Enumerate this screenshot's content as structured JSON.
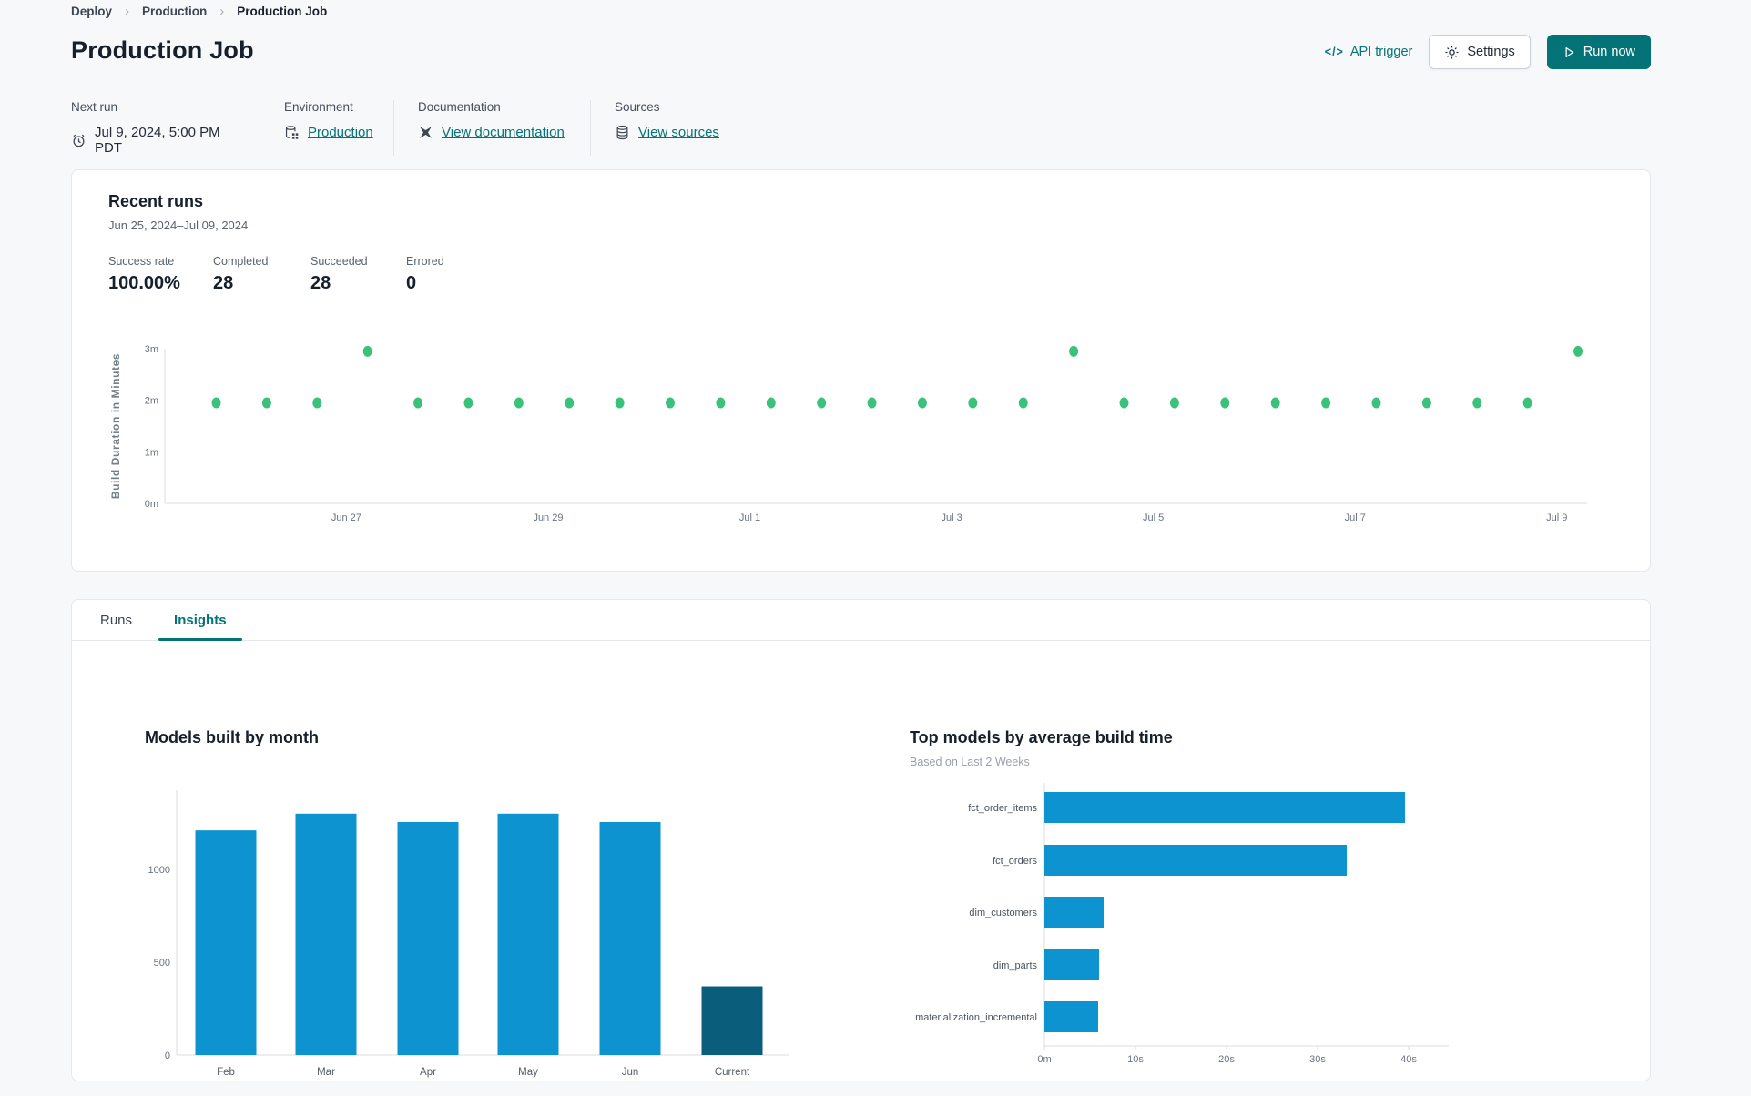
{
  "breadcrumb": {
    "separator": "›",
    "items": [
      "Deploy",
      "Production",
      "Production Job"
    ]
  },
  "header": {
    "title": "Production Job",
    "api_trigger": "API trigger",
    "settings": "Settings",
    "run_now": "Run now"
  },
  "icons": {
    "api_trigger_glyph": "</>",
    "clock": "alarm-clock",
    "environment": "database-grid",
    "documentation": "dbt-docs",
    "sources": "database-stack"
  },
  "meta": {
    "next_run": {
      "label": "Next run",
      "value": "Jul 9, 2024, 5:00 PM PDT"
    },
    "environment": {
      "label": "Environment",
      "value": "Production"
    },
    "documentation": {
      "label": "Documentation",
      "value": "View documentation"
    },
    "sources": {
      "label": "Sources",
      "value": "View sources"
    }
  },
  "recent_runs": {
    "title": "Recent runs",
    "date_range": "Jun 25, 2024–Jul 09, 2024",
    "stats": [
      {
        "label": "Success rate",
        "value": "100.00%"
      },
      {
        "label": "Completed",
        "value": "28"
      },
      {
        "label": "Succeeded",
        "value": "28"
      },
      {
        "label": "Errored",
        "value": "0"
      }
    ]
  },
  "tabs": {
    "runs": "Runs",
    "insights": "Insights"
  },
  "colors": {
    "accent_teal": "#047377",
    "success_green": "#3bc27a",
    "bar_blue": "#0d93cf",
    "bar_current": "#0b5d7c",
    "axis_line": "#d8dcdf"
  },
  "chart_data": [
    {
      "id": "build_duration",
      "type": "scatter",
      "title": "",
      "ylabel": "Build Duration in Minutes",
      "xlabel": "",
      "point_color": "#3bc27a",
      "xlim_days": [
        0.2,
        14.3
      ],
      "ylim_minutes": [
        0,
        3.2
      ],
      "x_ticks": [
        {
          "label": "Jun 27",
          "d": 2
        },
        {
          "label": "Jun 29",
          "d": 4
        },
        {
          "label": "Jul 1",
          "d": 6
        },
        {
          "label": "Jul 3",
          "d": 8
        },
        {
          "label": "Jul 5",
          "d": 10
        },
        {
          "label": "Jul 7",
          "d": 12
        },
        {
          "label": "Jul 9",
          "d": 14
        }
      ],
      "y_ticks": [
        {
          "label": "0m",
          "m": 0
        },
        {
          "label": "1m",
          "m": 1
        },
        {
          "label": "2m",
          "m": 2
        },
        {
          "label": "3m",
          "m": 3
        }
      ],
      "points": [
        {
          "d": 0.71,
          "m": 1.95
        },
        {
          "d": 1.21,
          "m": 1.95
        },
        {
          "d": 1.71,
          "m": 1.95
        },
        {
          "d": 2.21,
          "m": 2.95
        },
        {
          "d": 2.71,
          "m": 1.95
        },
        {
          "d": 3.21,
          "m": 1.95
        },
        {
          "d": 3.71,
          "m": 1.95
        },
        {
          "d": 4.21,
          "m": 1.95
        },
        {
          "d": 4.71,
          "m": 1.95
        },
        {
          "d": 5.21,
          "m": 1.95
        },
        {
          "d": 5.71,
          "m": 1.95
        },
        {
          "d": 6.21,
          "m": 1.95
        },
        {
          "d": 6.71,
          "m": 1.95
        },
        {
          "d": 7.21,
          "m": 1.95
        },
        {
          "d": 7.71,
          "m": 1.95
        },
        {
          "d": 8.21,
          "m": 1.95
        },
        {
          "d": 8.71,
          "m": 1.95
        },
        {
          "d": 9.21,
          "m": 2.95
        },
        {
          "d": 9.71,
          "m": 1.95
        },
        {
          "d": 10.21,
          "m": 1.95
        },
        {
          "d": 10.71,
          "m": 1.95
        },
        {
          "d": 11.21,
          "m": 1.95
        },
        {
          "d": 11.71,
          "m": 1.95
        },
        {
          "d": 12.21,
          "m": 1.95
        },
        {
          "d": 12.71,
          "m": 1.95
        },
        {
          "d": 13.21,
          "m": 1.95
        },
        {
          "d": 13.71,
          "m": 1.95
        },
        {
          "d": 14.21,
          "m": 2.95
        }
      ]
    },
    {
      "id": "models_by_month",
      "type": "bar",
      "title": "Models built by month",
      "xlabel": "",
      "ylabel": "",
      "categories": [
        "Feb",
        "Mar",
        "Apr",
        "May",
        "Jun",
        "Current"
      ],
      "values": [
        1210,
        1300,
        1255,
        1300,
        1255,
        370
      ],
      "bar_colors": [
        "#0d93cf",
        "#0d93cf",
        "#0d93cf",
        "#0d93cf",
        "#0d93cf",
        "#0b5d7c"
      ],
      "y_ticks": [
        0,
        500,
        1000
      ],
      "ylim": [
        0,
        1400
      ]
    },
    {
      "id": "top_models",
      "type": "horizontal_bar",
      "title": "Top models by average build time",
      "subtitle": "Based on Last 2 Weeks",
      "categories": [
        "fct_order_items",
        "fct_orders",
        "dim_customers",
        "dim_parts",
        "materialization_incremental"
      ],
      "values_seconds": [
        39.6,
        33.2,
        6.5,
        6.0,
        5.9
      ],
      "x_ticks": [
        {
          "label": "0m",
          "s": 0
        },
        {
          "label": "10s",
          "s": 10
        },
        {
          "label": "20s",
          "s": 20
        },
        {
          "label": "30s",
          "s": 30
        },
        {
          "label": "40s",
          "s": 40
        }
      ],
      "xlim_seconds": [
        0,
        43.5
      ],
      "bar_color": "#0d93cf"
    }
  ]
}
